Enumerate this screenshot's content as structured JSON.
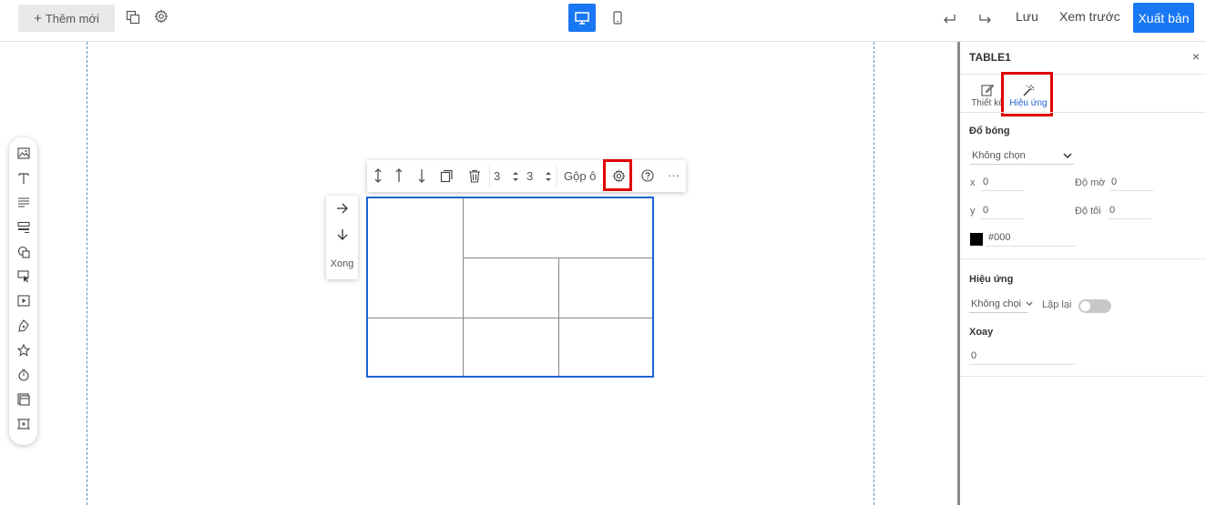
{
  "topbar": {
    "add_new_label": "Thêm mới",
    "save_label": "Lưu",
    "preview_label": "Xem trước",
    "publish_label": "Xuất bản",
    "accent_color": "#1877f2",
    "icons": [
      "copy-layers-icon",
      "gear-icon",
      "desktop-icon",
      "mobile-icon",
      "undo-icon",
      "redo-icon"
    ]
  },
  "table_toolbar": {
    "rows_value": "3",
    "cols_value": "3",
    "merge_label": "Gộp ô",
    "more_label": "···",
    "icons": [
      "row-height-icon",
      "move-up-icon",
      "move-down-icon",
      "duplicate-icon",
      "trash-icon",
      "gear-icon",
      "help-icon",
      "more-icon"
    ]
  },
  "direction_panel": {
    "done_label": "Xong"
  },
  "left_toolbar": {
    "items": [
      "image-icon",
      "text-icon",
      "paragraph-icon",
      "form-icon",
      "shapes-icon",
      "click-icon",
      "video-icon",
      "pen-icon",
      "star-icon",
      "timer-icon",
      "gallery-icon",
      "frame-icon"
    ]
  },
  "right_panel": {
    "title": "TABLE1",
    "close_label": "×",
    "tabs": [
      {
        "label": "Thiết kế",
        "active": false
      },
      {
        "label": "Hiệu ứng",
        "active": true
      }
    ],
    "shadow": {
      "title": "Đổ bóng",
      "select_value": "Không chọn",
      "x_label": "x",
      "x_value": "0",
      "blur_label": "Độ mờ",
      "blur_value": "0",
      "y_label": "y",
      "y_value": "0",
      "dark_label": "Độ tối",
      "dark_value": "0",
      "color_value": "#000"
    },
    "effect": {
      "title": "Hiệu ứng",
      "select_value": "Không chọi",
      "repeat_label": "Lặp lại",
      "repeat_on": false
    },
    "rotate": {
      "title": "Xoay",
      "value": "0"
    }
  }
}
